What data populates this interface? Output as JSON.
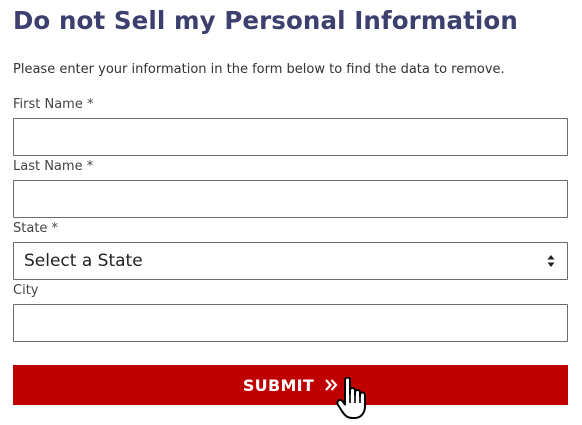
{
  "form": {
    "title": "Do not Sell my Personal Information",
    "intro": "Please enter your information in the form below to find the data to remove.",
    "first_name": {
      "label": "First Name *",
      "value": ""
    },
    "last_name": {
      "label": "Last Name *",
      "value": ""
    },
    "state": {
      "label": "State *",
      "selected": "Select a State"
    },
    "city": {
      "label": "City",
      "value": ""
    },
    "submit_label": "SUBMIT"
  },
  "icons": {
    "submit_chevron": "double-chevron-right-icon",
    "select_arrows": "up-down-arrows-icon",
    "cursor": "hand-pointer-cursor-icon"
  },
  "colors": {
    "title": "#3d3f6e",
    "submit_background": "#c00000",
    "submit_text": "#ffffff",
    "field_border": "#6b6b6b"
  }
}
